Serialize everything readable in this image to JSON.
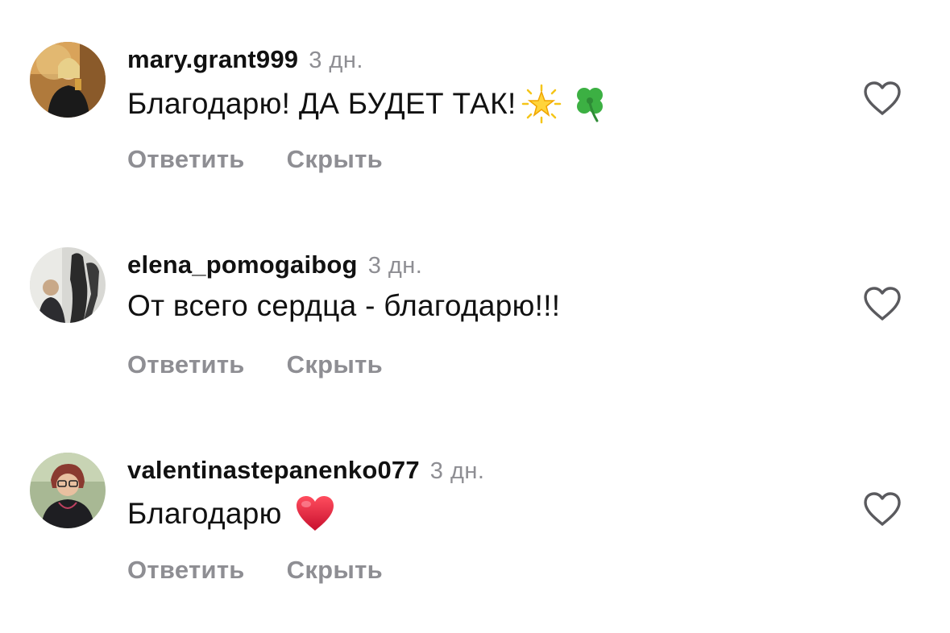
{
  "comments": [
    {
      "username": "mary.grant999",
      "time": "3 дн.",
      "text": "Благодарю! ДА БУДЕТ ТАК!",
      "emojis": [
        "glowing-star",
        "four-leaf-clover"
      ],
      "reply_label": "Ответить",
      "hide_label": "Скрыть",
      "like_icon": "heart-outline-icon"
    },
    {
      "username": "elena_pomogaibog",
      "time": "3 дн.",
      "text": "От всего сердца - благодарю!!!",
      "emojis": [],
      "reply_label": "Ответить",
      "hide_label": "Скрыть",
      "like_icon": "heart-outline-icon"
    },
    {
      "username": "valentinastepanenko077",
      "time": "3 дн.",
      "text": "Благодарю",
      "emojis": [
        "red-heart"
      ],
      "reply_label": "Ответить",
      "hide_label": "Скрыть",
      "like_icon": "heart-outline-icon"
    }
  ],
  "colors": {
    "text": "#111111",
    "muted": "#8e8e93",
    "background": "#ffffff"
  }
}
